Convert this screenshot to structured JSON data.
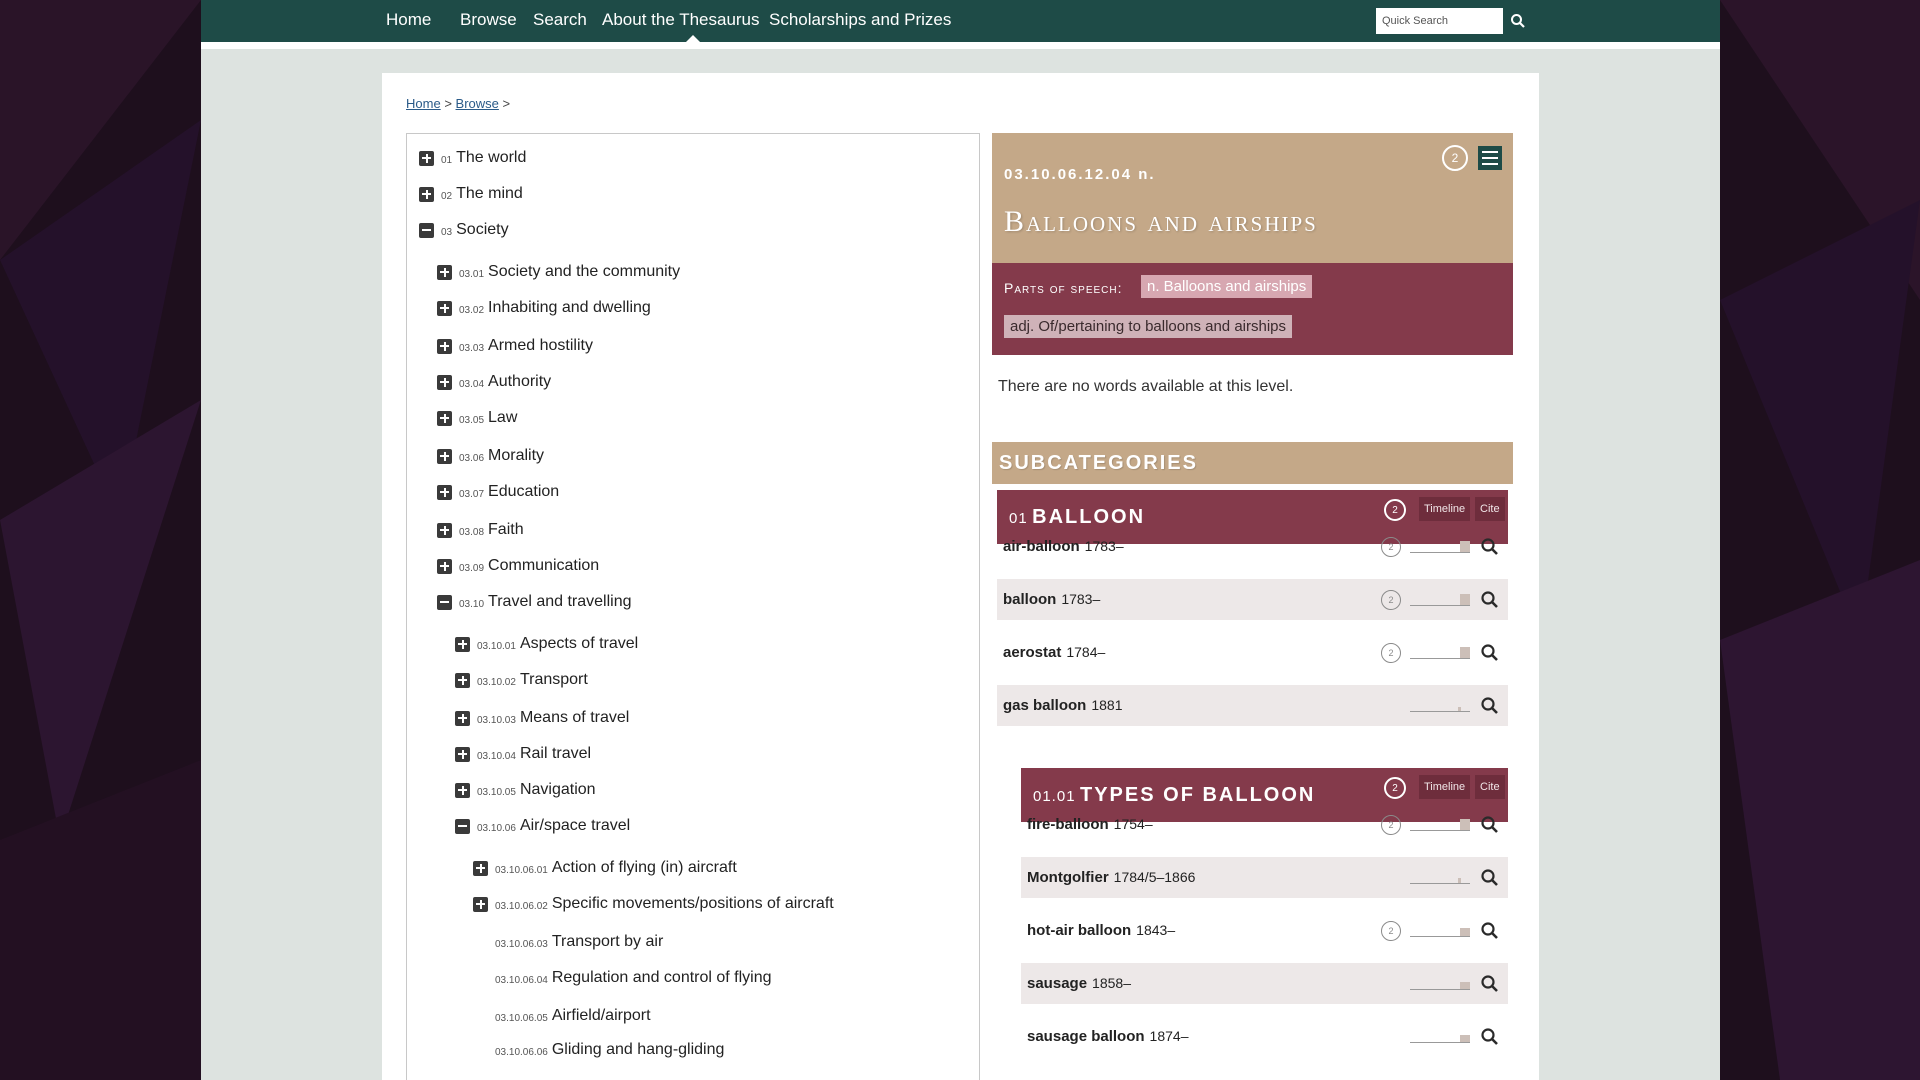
{
  "nav": {
    "items": [
      "Home",
      "Browse",
      "Search",
      "About the Thesaurus",
      "Scholarships and Prizes"
    ],
    "active": "Browse",
    "quick_search_placeholder": "Quick Search"
  },
  "breadcrumb": {
    "home": "Home",
    "browse": "Browse",
    "sep": ">"
  },
  "tree": [
    {
      "num": "01",
      "label": "The world",
      "toggle": "plus",
      "depth": 0
    },
    {
      "num": "02",
      "label": "The mind",
      "toggle": "plus",
      "depth": 0
    },
    {
      "num": "03",
      "label": "Society",
      "toggle": "minus",
      "depth": 0
    },
    {
      "num": "03.01",
      "label": "Society and the community",
      "toggle": "plus",
      "depth": 1
    },
    {
      "num": "03.02",
      "label": "Inhabiting and dwelling",
      "toggle": "plus",
      "depth": 1
    },
    {
      "num": "03.03",
      "label": "Armed hostility",
      "toggle": "plus",
      "depth": 1
    },
    {
      "num": "03.04",
      "label": "Authority",
      "toggle": "plus",
      "depth": 1
    },
    {
      "num": "03.05",
      "label": "Law",
      "toggle": "plus",
      "depth": 1
    },
    {
      "num": "03.06",
      "label": "Morality",
      "toggle": "plus",
      "depth": 1
    },
    {
      "num": "03.07",
      "label": "Education",
      "toggle": "plus",
      "depth": 1
    },
    {
      "num": "03.08",
      "label": "Faith",
      "toggle": "plus",
      "depth": 1
    },
    {
      "num": "03.09",
      "label": "Communication",
      "toggle": "plus",
      "depth": 1
    },
    {
      "num": "03.10",
      "label": "Travel and travelling",
      "toggle": "minus",
      "depth": 1
    },
    {
      "num": "03.10.01",
      "label": "Aspects of travel",
      "toggle": "plus",
      "depth": 2
    },
    {
      "num": "03.10.02",
      "label": "Transport",
      "toggle": "plus",
      "depth": 2
    },
    {
      "num": "03.10.03",
      "label": "Means of travel",
      "toggle": "plus",
      "depth": 2
    },
    {
      "num": "03.10.04",
      "label": "Rail travel",
      "toggle": "plus",
      "depth": 2
    },
    {
      "num": "03.10.05",
      "label": "Navigation",
      "toggle": "plus",
      "depth": 2
    },
    {
      "num": "03.10.06",
      "label": "Air/space travel",
      "toggle": "minus",
      "depth": 2
    },
    {
      "num": "03.10.06.01",
      "label": "Action of flying (in) aircraft",
      "toggle": "plus",
      "depth": 3
    },
    {
      "num": "03.10.06.02",
      "label": "Specific movements/positions of aircraft",
      "toggle": "plus",
      "depth": 3
    },
    {
      "num": "03.10.06.03",
      "label": "Transport by air",
      "toggle": "none",
      "depth": 3
    },
    {
      "num": "03.10.06.04",
      "label": "Regulation and control of flying",
      "toggle": "none",
      "depth": 3
    },
    {
      "num": "03.10.06.05",
      "label": "Airfield/airport",
      "toggle": "none",
      "depth": 3
    },
    {
      "num": "03.10.06.06",
      "label": "Gliding and hang-gliding",
      "toggle": "none",
      "depth": 3
    }
  ],
  "heading": {
    "code": "03.10.06.12.04 n.",
    "title": "Balloons and airships",
    "circle": "2"
  },
  "parts_of_speech": {
    "label": "Parts of speech:",
    "chips": [
      "n. Balloons and airships",
      "adj. Of/pertaining to balloons and airships"
    ]
  },
  "no_words": "There are no words available at this level.",
  "subcategories_title": "SUBCATEGORIES",
  "categories": [
    {
      "num": "01",
      "name": "BALLOON",
      "circle": "2",
      "timeline": "Timeline",
      "cite": "Cite",
      "words": [
        {
          "name": "air-balloon",
          "date": "1783–",
          "circle": "2",
          "level": 0.9
        },
        {
          "name": "balloon",
          "date": "1783–",
          "circle": "2",
          "level": 0.9
        },
        {
          "name": "aerostat",
          "date": "1784–",
          "circle": "2",
          "level": 0.9
        },
        {
          "name": "gas balloon",
          "date": "1881",
          "circle": "",
          "level": 0.3
        }
      ]
    },
    {
      "num": "01.01",
      "name": "TYPES OF BALLOON",
      "circle": "2",
      "timeline": "Timeline",
      "cite": "Cite",
      "words": [
        {
          "name": "fire-balloon",
          "date": "1754–",
          "circle": "2",
          "level": 0.9
        },
        {
          "name": "Montgolfier",
          "date": "1784/5–1866",
          "circle": "",
          "level": 0.4
        },
        {
          "name": "hot-air balloon",
          "date": "1843–",
          "circle": "2",
          "level": 0.7
        },
        {
          "name": "sausage",
          "date": "1858–",
          "circle": "",
          "level": 0.6
        },
        {
          "name": "sausage balloon",
          "date": "1874–",
          "circle": "",
          "level": 0.6
        }
      ]
    }
  ],
  "colors": {
    "nav_bg": "#1e4b47",
    "heading_tan": "#c4a888",
    "category_maroon": "#843a4b",
    "page_bg": "#dde3e0"
  }
}
